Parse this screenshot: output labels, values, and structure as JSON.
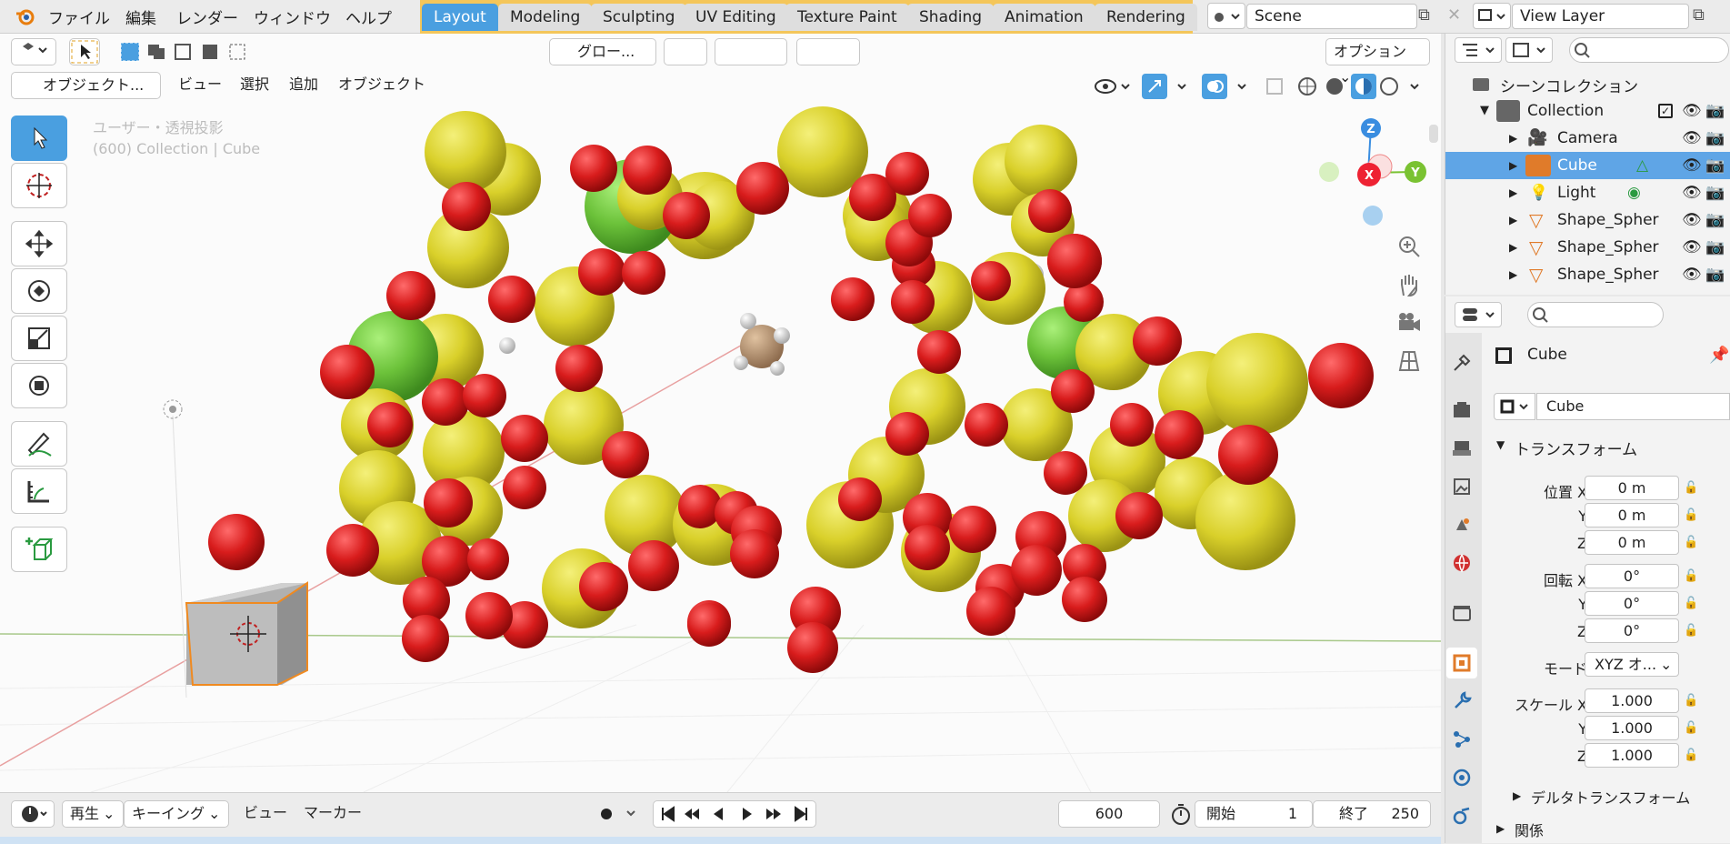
{
  "menu": [
    "ファイル",
    "編集",
    "レンダー",
    "ウィンドウ",
    "ヘルプ"
  ],
  "workspaces": [
    "Layout",
    "Modeling",
    "Sculpting",
    "UV Editing",
    "Texture Paint",
    "Shading",
    "Animation",
    "Rendering"
  ],
  "active_workspace": "Layout",
  "scene": "Scene",
  "view_layer": "View Layer",
  "viewport_header": {
    "orientation": "グロー...",
    "options": "オプション",
    "mode": "オブジェクト...",
    "view": "ビュー",
    "select": "選択",
    "add": "追加",
    "object": "オブジェクト"
  },
  "overlay_text": {
    "view_name": "ユーザー・透視投影",
    "collection_info": "(600) Collection | Cube"
  },
  "gizmo": {
    "z": "Z",
    "x": "X",
    "y": "Y"
  },
  "outliner": {
    "title": "シーンコレクション",
    "collection": "Collection",
    "items": [
      "Camera",
      "Cube",
      "Light",
      "Shape_Spher",
      "Shape_Spher",
      "Shape_Spher"
    ],
    "selected": "Cube"
  },
  "properties": {
    "object_name": "Cube",
    "data_name": "Cube",
    "transform_title": "トランスフォーム",
    "location_label": "位置 X",
    "location": [
      "0 m",
      "0 m",
      "0 m"
    ],
    "rotation_label": "回転 X",
    "rotation": [
      "0°",
      "0°",
      "0°"
    ],
    "mode_label": "モード",
    "mode_value": "XYZ オ...",
    "scale_label": "スケール X",
    "scale": [
      "1.000",
      "1.000",
      "1.000"
    ],
    "axis_y": "Y",
    "axis_z": "Z",
    "delta_transform": "デルタトランスフォーム",
    "relations": "関係"
  },
  "timeline": {
    "playback": "再生",
    "keying": "キーイング",
    "view": "ビュー",
    "marker": "マーカー",
    "current_frame": "600",
    "start_label": "開始",
    "start": "1",
    "end_label": "終了",
    "end": "250"
  },
  "colors": {
    "accent": "#4a9fe0",
    "sphere_red": "#d42020",
    "sphere_yellow": "#d8d02a",
    "sphere_green": "#6cc23a",
    "axis_x": "#ee2233",
    "axis_y": "#7ac232",
    "axis_z": "#3a8de0"
  }
}
